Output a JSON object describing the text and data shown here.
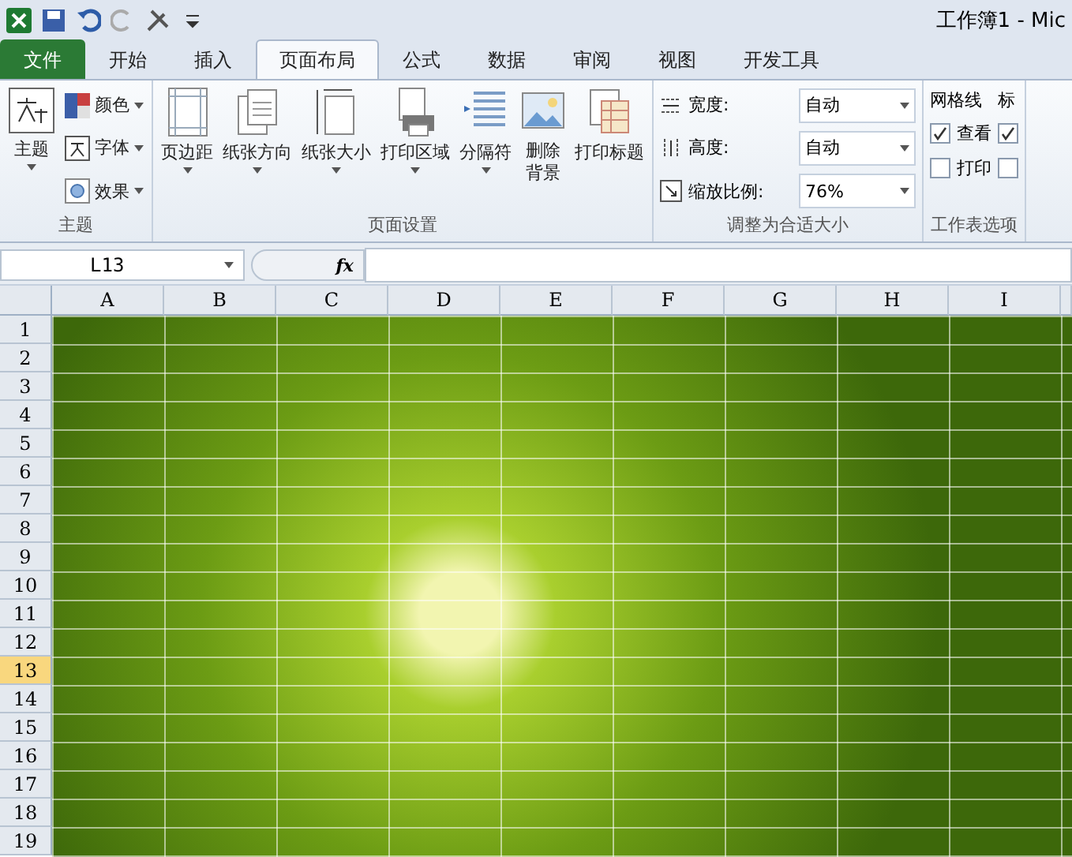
{
  "window": {
    "title": "工作簿1 - Mic"
  },
  "tabs": [
    {
      "label": "文件",
      "kind": "file",
      "selected": false
    },
    {
      "label": "开始",
      "kind": "tab",
      "selected": false
    },
    {
      "label": "插入",
      "kind": "tab",
      "selected": false
    },
    {
      "label": "页面布局",
      "kind": "tab",
      "selected": true
    },
    {
      "label": "公式",
      "kind": "tab",
      "selected": false
    },
    {
      "label": "数据",
      "kind": "tab",
      "selected": false
    },
    {
      "label": "审阅",
      "kind": "tab",
      "selected": false
    },
    {
      "label": "视图",
      "kind": "tab",
      "selected": false
    },
    {
      "label": "开发工具",
      "kind": "tab",
      "selected": false
    }
  ],
  "ribbon": {
    "theme_group": {
      "title": "主题",
      "main": "主题",
      "items": [
        "颜色",
        "字体",
        "效果"
      ]
    },
    "page_setup": {
      "title": "页面设置",
      "buttons": [
        "页边距",
        "纸张方向",
        "纸张大小",
        "打印区域",
        "分隔符",
        "删除背景",
        "打印标题"
      ]
    },
    "scale_group": {
      "title": "调整为合适大小",
      "fields": [
        {
          "label": "宽度:",
          "value": "自动"
        },
        {
          "label": "高度:",
          "value": "自动"
        },
        {
          "label": "缩放比例:",
          "value": "76%"
        }
      ]
    },
    "sheet_options": {
      "title": "工作表选项",
      "columns": [
        {
          "heading": "网格线",
          "options": [
            {
              "label": "查看",
              "checked": true
            },
            {
              "label": "打印",
              "checked": false
            }
          ]
        },
        {
          "heading": "标",
          "options": [
            {
              "checked": true
            },
            {
              "checked": false
            }
          ]
        }
      ]
    }
  },
  "formula_bar": {
    "name_box": "L13",
    "fx": "fx"
  },
  "sheet": {
    "columns": [
      "A",
      "B",
      "C",
      "D",
      "E",
      "F",
      "G",
      "H",
      "I"
    ],
    "rows": [
      {
        "label": "1",
        "selected": false
      },
      {
        "label": "2",
        "selected": false
      },
      {
        "label": "3",
        "selected": false
      },
      {
        "label": "4",
        "selected": false
      },
      {
        "label": "5",
        "selected": false
      },
      {
        "label": "6",
        "selected": false
      },
      {
        "label": "7",
        "selected": false
      },
      {
        "label": "8",
        "selected": false
      },
      {
        "label": "9",
        "selected": false
      },
      {
        "label": "10",
        "selected": false
      },
      {
        "label": "11",
        "selected": false
      },
      {
        "label": "12",
        "selected": false
      },
      {
        "label": "13",
        "selected": true
      },
      {
        "label": "14",
        "selected": false
      },
      {
        "label": "15",
        "selected": false
      },
      {
        "label": "16",
        "selected": false
      },
      {
        "label": "17",
        "selected": false
      },
      {
        "label": "18",
        "selected": false
      },
      {
        "label": "19",
        "selected": false
      }
    ]
  }
}
